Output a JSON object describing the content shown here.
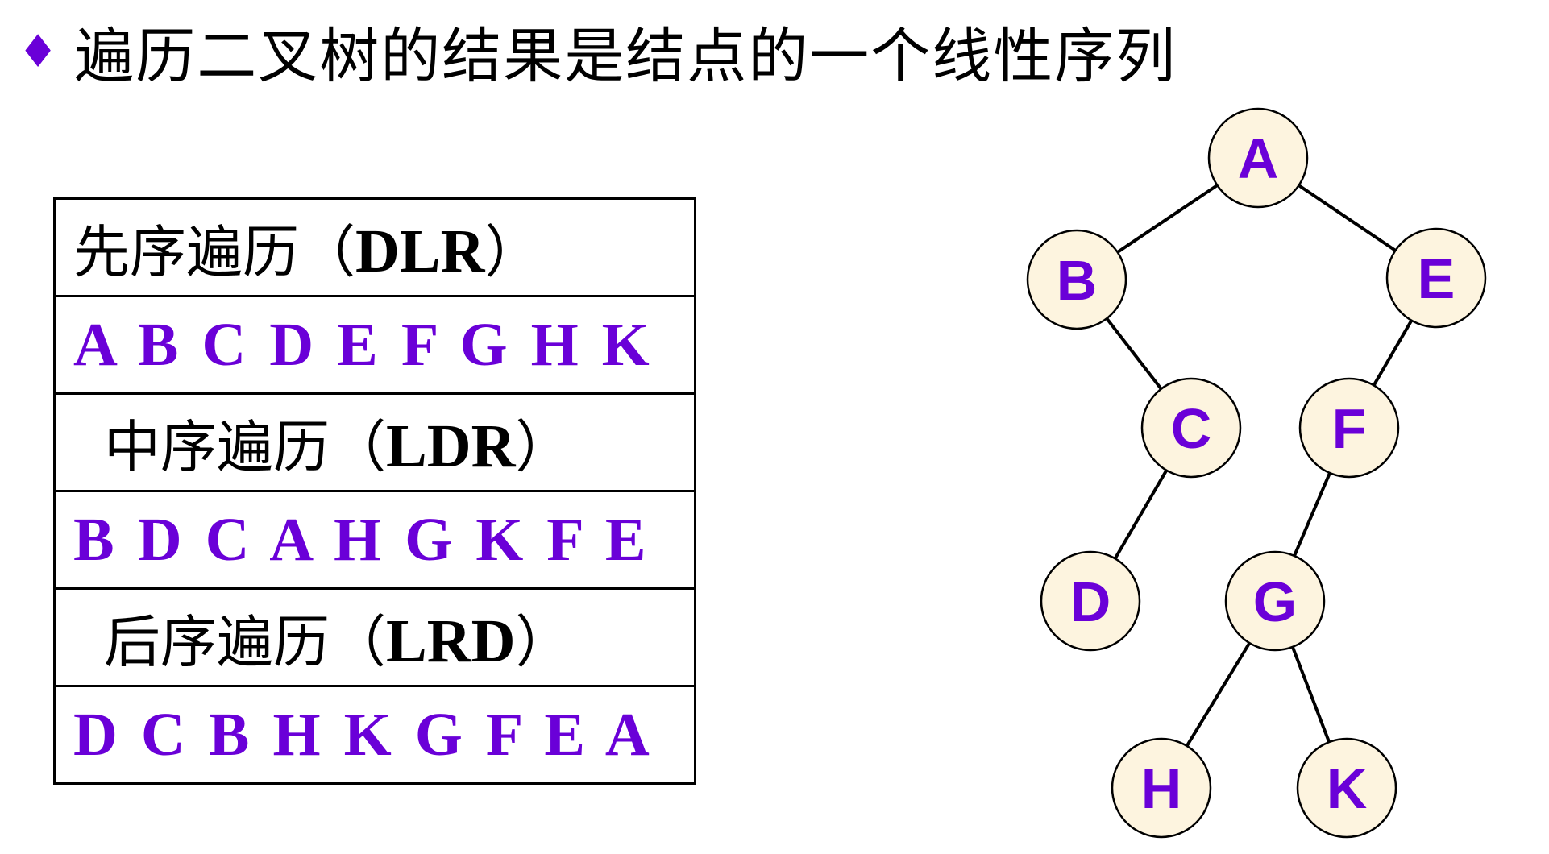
{
  "title": {
    "bullet": "♦",
    "text": "遍历二叉树的结果是结点的一个线性序列"
  },
  "traversal_table": {
    "rows": [
      {
        "label_cn": "先序遍历（",
        "label_code": "DLR",
        "label_close": "）",
        "sequence": "A B C D E F G H K"
      },
      {
        "label_cn": "中序遍历（",
        "label_code": "LDR",
        "label_close": "）",
        "sequence": "B D C A H G K F E"
      },
      {
        "label_cn": "后序遍历（",
        "label_code": "LRD",
        "label_close": "）",
        "sequence": "D C B H K G F E A"
      }
    ]
  },
  "tree": {
    "nodes": [
      "A",
      "B",
      "E",
      "C",
      "F",
      "D",
      "G",
      "H",
      "K"
    ],
    "edges": [
      [
        "A",
        "B"
      ],
      [
        "A",
        "E"
      ],
      [
        "B",
        "C"
      ],
      [
        "E",
        "F"
      ],
      [
        "C",
        "D"
      ],
      [
        "F",
        "G"
      ],
      [
        "G",
        "H"
      ],
      [
        "G",
        "K"
      ]
    ]
  },
  "colors": {
    "accent": "#6a00d8",
    "node_fill": "#fdf4df",
    "text": "#000000"
  }
}
